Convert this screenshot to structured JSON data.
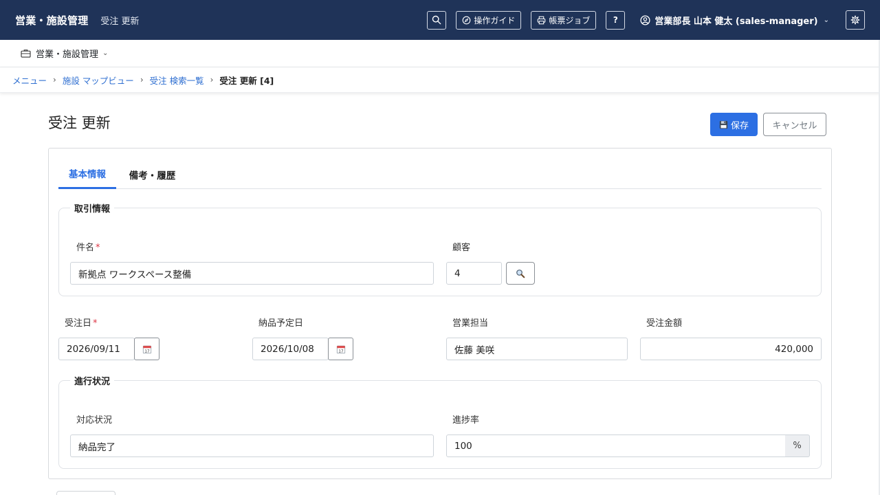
{
  "header": {
    "brand": "営業・施設管理",
    "page_subtitle": "受注 更新",
    "guide_label": "操作ガイド",
    "report_jobs_label": "帳票ジョブ",
    "help_label": "?",
    "user_label": "営業部長 山本 健太 (sales-manager)"
  },
  "subnav": {
    "label": "営業・施設管理"
  },
  "breadcrumb": {
    "items": [
      "メニュー",
      "施設 マップビュー",
      "受注 検索一覧"
    ],
    "separator": "›",
    "current": "受注 更新 [4]"
  },
  "page": {
    "title": "受注 更新",
    "save_label": "保存",
    "cancel_label": "キャンセル"
  },
  "tabs": [
    {
      "label": "基本情報",
      "active": true
    },
    {
      "label": "備考・履歴",
      "active": false
    }
  ],
  "transaction": {
    "legend": "取引情報",
    "subject_label": "件名",
    "subject_value": "新拠点 ワークスペース整備",
    "customer_label": "顧客",
    "customer_value": "4"
  },
  "dates": {
    "order_date_label": "受注日",
    "order_date_value": "2026/09/11",
    "delivery_date_label": "納品予定日",
    "delivery_date_value": "2026/10/08",
    "sales_rep_label": "営業担当",
    "sales_rep_value": "佐藤 美咲",
    "amount_label": "受注金額",
    "amount_value": "420,000"
  },
  "progress": {
    "legend": "進行状況",
    "status_label": "対応状況",
    "status_value": "納品完了",
    "rate_label": "進捗率",
    "rate_value": "100",
    "rate_unit": "%"
  },
  "required_mark": "*",
  "colors": {
    "navbar": "#1f3358",
    "primary": "#2c6fe3",
    "link": "#2f6fd1",
    "required": "#dc3545"
  }
}
